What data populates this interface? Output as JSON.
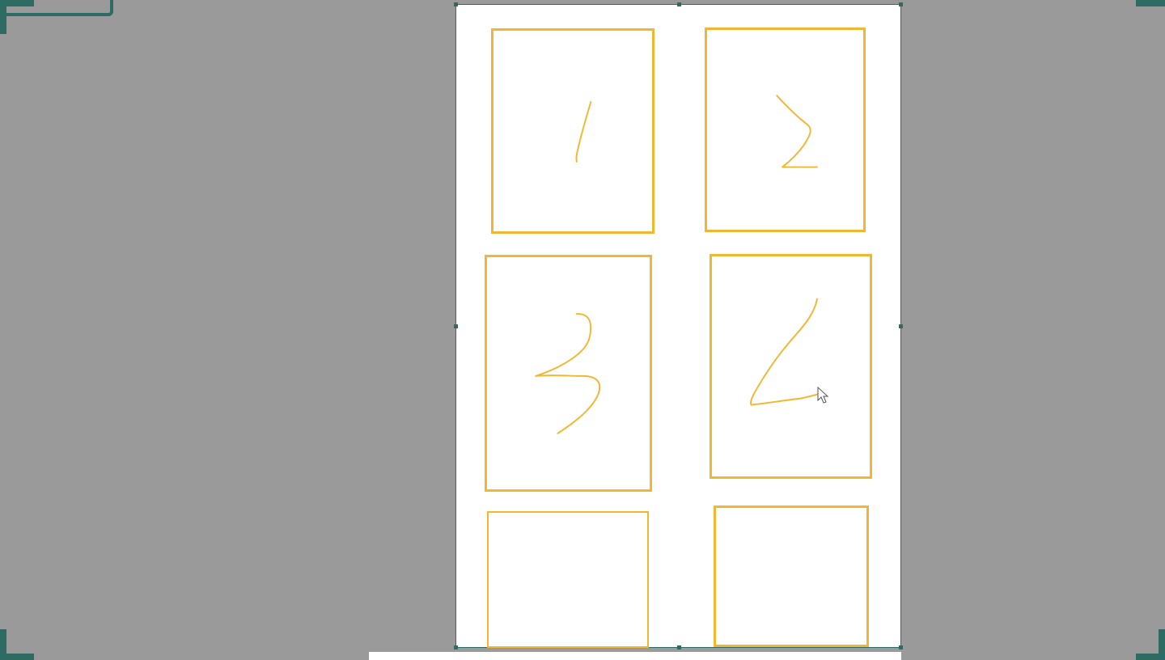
{
  "canvas": {
    "accent_color": "#f2b731",
    "frame_color": "#2e6b63",
    "background_color": "#9a9a9a"
  },
  "panels": [
    {
      "id": "panel-1",
      "drawing": "handwritten-1"
    },
    {
      "id": "panel-2",
      "drawing": "handwritten-2"
    },
    {
      "id": "panel-3",
      "drawing": "handwritten-3"
    },
    {
      "id": "panel-4",
      "drawing": "handwritten-4"
    },
    {
      "id": "panel-5",
      "drawing": "empty"
    },
    {
      "id": "panel-6",
      "drawing": "empty"
    }
  ],
  "cursor": {
    "icon": "pointer-arrow-icon"
  }
}
